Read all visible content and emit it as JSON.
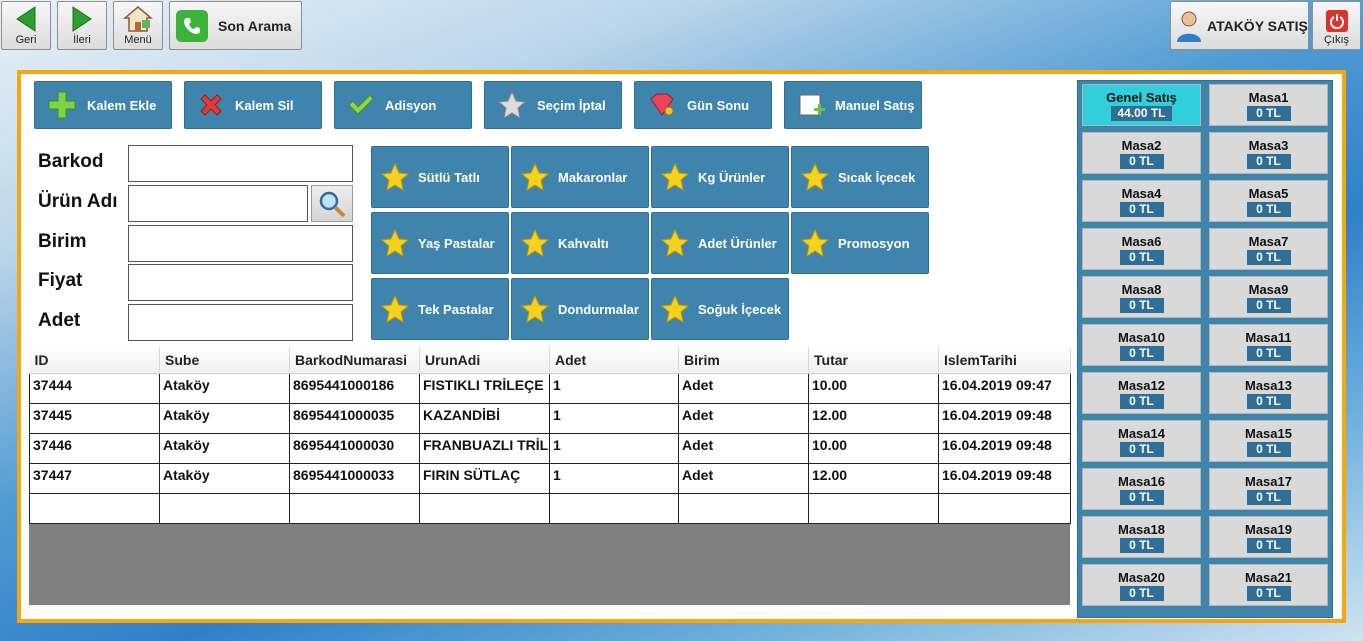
{
  "topbar": {
    "back_label": "Geri",
    "forward_label": "İleri",
    "menu_label": "Menü",
    "last_call_label": "Son Arama",
    "user_label": "ATAKÖY SATIŞ",
    "exit_label": "Çıkış"
  },
  "actions": {
    "add_item": "Kalem Ekle",
    "delete_item": "Kalem Sil",
    "bill": "Adisyon",
    "cancel_selection": "Seçim İptal",
    "end_of_day": "Gün Sonu",
    "manual_sale": "Manuel Satış"
  },
  "form": {
    "barcode_label": "Barkod",
    "product_name_label": "Ürün Adı",
    "unit_label": "Birim",
    "price_label": "Fiyat",
    "quantity_label": "Adet",
    "barcode_value": "",
    "product_name_value": "",
    "unit_value": "",
    "price_value": "",
    "quantity_value": ""
  },
  "categories": [
    "Sütlü Tatlı",
    "Makaronlar",
    "Kg Ürünler",
    "Sıcak İçecek",
    "Yaş Pastalar",
    "Kahvaltı",
    "Adet Ürünler",
    "Promosyon",
    "Tek Pastalar",
    "Dondurmalar",
    "Soğuk İçecek"
  ],
  "grid": {
    "columns": [
      "ID",
      "Sube",
      "BarkodNumarasi",
      "UrunAdi",
      "Adet",
      "Birim",
      "Tutar",
      "IslemTarihi"
    ],
    "rows": [
      [
        "37444",
        "Ataköy",
        "8695441000186",
        "FISTIKLI TRİLEÇE",
        "1",
        "Adet",
        "10.00",
        "16.04.2019 09:47"
      ],
      [
        "37445",
        "Ataköy",
        "8695441000035",
        "KAZANDİBİ",
        "1",
        "Adet",
        "12.00",
        "16.04.2019 09:48"
      ],
      [
        "37446",
        "Ataköy",
        "8695441000030",
        "FRANBUAZLI TRİLEÇE",
        "1",
        "Adet",
        "10.00",
        "16.04.2019 09:48"
      ],
      [
        "37447",
        "Ataköy",
        "8695441000033",
        "FIRIN SÜTLAÇ",
        "1",
        "Adet",
        "12.00",
        "16.04.2019 09:48"
      ],
      [
        "",
        "",
        "",
        "",
        "",
        "",
        "",
        ""
      ]
    ]
  },
  "tables": [
    {
      "name": "Genel Satış",
      "amount": "44.00 TL"
    },
    {
      "name": "Masa1",
      "amount": "0 TL"
    },
    {
      "name": "Masa2",
      "amount": "0 TL"
    },
    {
      "name": "Masa3",
      "amount": "0 TL"
    },
    {
      "name": "Masa4",
      "amount": "0 TL"
    },
    {
      "name": "Masa5",
      "amount": "0 TL"
    },
    {
      "name": "Masa6",
      "amount": "0 TL"
    },
    {
      "name": "Masa7",
      "amount": "0 TL"
    },
    {
      "name": "Masa8",
      "amount": "0 TL"
    },
    {
      "name": "Masa9",
      "amount": "0 TL"
    },
    {
      "name": "Masa10",
      "amount": "0 TL"
    },
    {
      "name": "Masa11",
      "amount": "0 TL"
    },
    {
      "name": "Masa12",
      "amount": "0 TL"
    },
    {
      "name": "Masa13",
      "amount": "0 TL"
    },
    {
      "name": "Masa14",
      "amount": "0 TL"
    },
    {
      "name": "Masa15",
      "amount": "0 TL"
    },
    {
      "name": "Masa16",
      "amount": "0 TL"
    },
    {
      "name": "Masa17",
      "amount": "0 TL"
    },
    {
      "name": "Masa18",
      "amount": "0 TL"
    },
    {
      "name": "Masa19",
      "amount": "0 TL"
    },
    {
      "name": "Masa20",
      "amount": "0 TL"
    },
    {
      "name": "Masa21",
      "amount": "0 TL"
    }
  ],
  "colors": {
    "accent_blue": "#3e84ad",
    "frame_orange": "#f5a70c",
    "active_table": "#2fd0db",
    "amount_badge": "#2f6f97"
  }
}
